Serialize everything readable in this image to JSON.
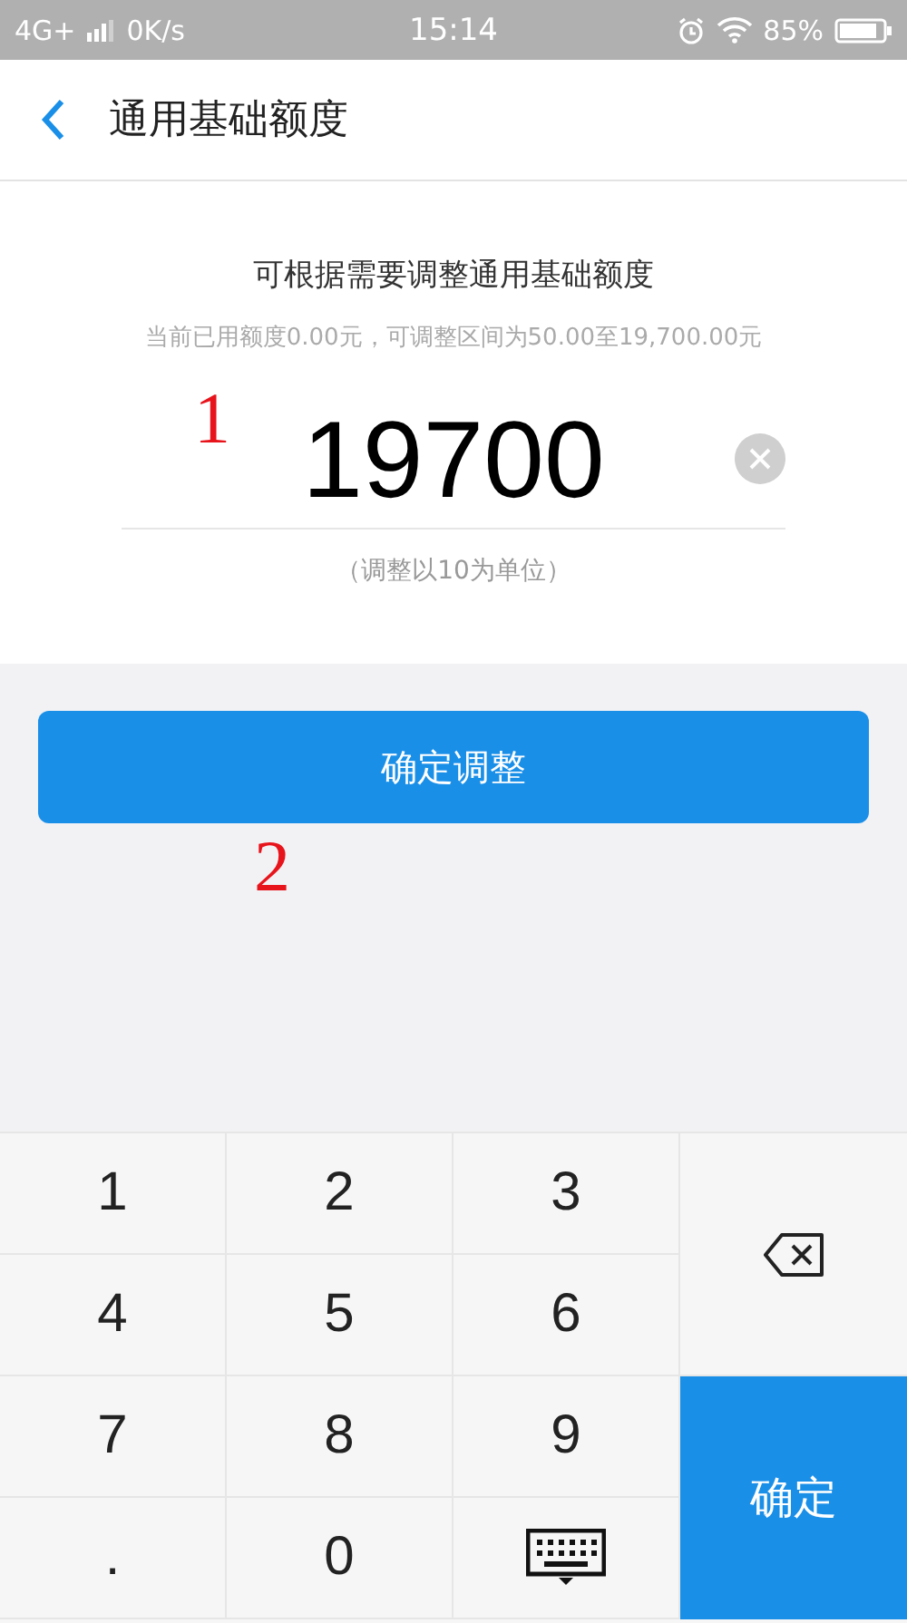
{
  "status_bar": {
    "network": "4G+",
    "speed": "0K/s",
    "time": "15:14",
    "battery": "85%"
  },
  "header": {
    "title": "通用基础额度"
  },
  "form": {
    "heading": "可根据需要调整通用基础额度",
    "hint": "当前已用额度0.00元，可调整区间为50.00至19,700.00元",
    "value": "19700",
    "note": "（调整以10为单位）"
  },
  "confirm_button": "确定调整",
  "annotations": [
    {
      "text": "1"
    },
    {
      "text": "2"
    }
  ],
  "keypad": [
    {
      "kind": "digit",
      "label": "1"
    },
    {
      "kind": "digit",
      "label": "2"
    },
    {
      "kind": "digit",
      "label": "3"
    },
    {
      "kind": "backspace"
    },
    {
      "kind": "digit",
      "label": "4"
    },
    {
      "kind": "digit",
      "label": "5"
    },
    {
      "kind": "digit",
      "label": "6"
    },
    {
      "kind": "digit",
      "label": "7"
    },
    {
      "kind": "digit",
      "label": "8"
    },
    {
      "kind": "digit",
      "label": "9"
    },
    {
      "kind": "confirm",
      "label": "确定"
    },
    {
      "kind": "digit",
      "label": "."
    },
    {
      "kind": "digit",
      "label": "0"
    },
    {
      "kind": "hide-keyboard"
    }
  ]
}
